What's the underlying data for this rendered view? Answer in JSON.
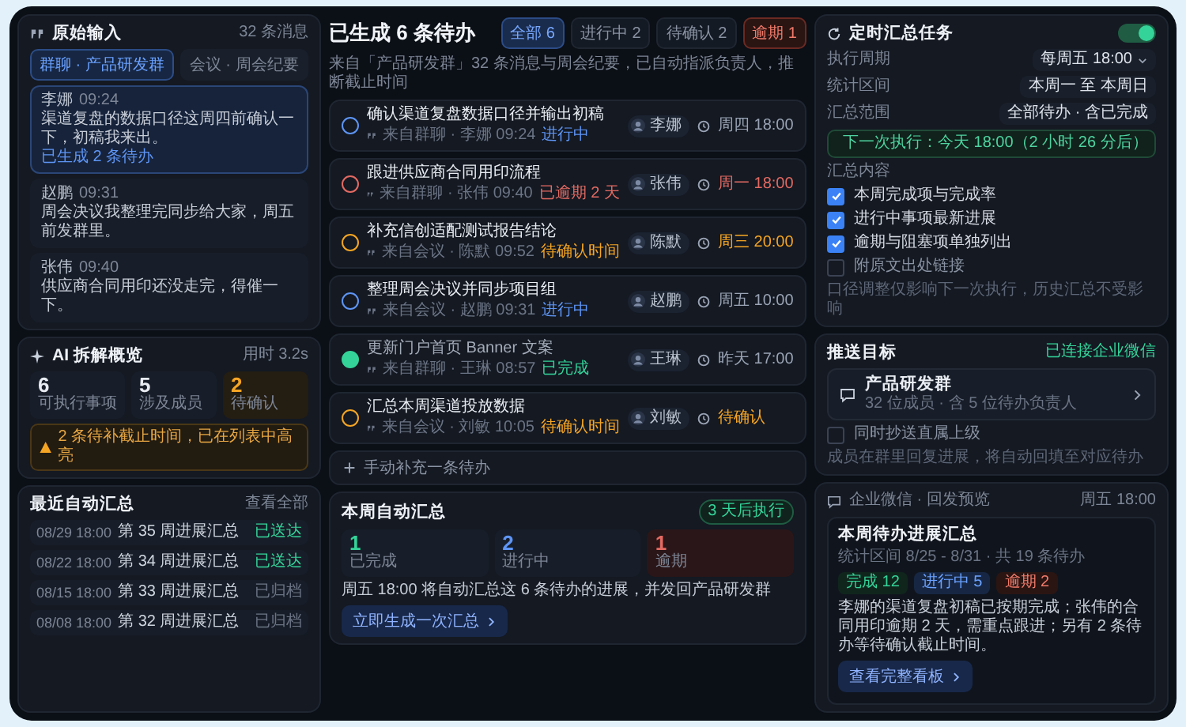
{
  "raw_input": {
    "title": "原始输入",
    "count": "32 条消息",
    "tabs": [
      {
        "label": "群聊 · 产品研发群",
        "selected": true
      },
      {
        "label": "会议 · 周会纪要",
        "selected": false
      }
    ],
    "messages": [
      {
        "author": "李娜",
        "time": "09:24",
        "text": "渠道复盘的数据口径这周四前确认一下，初稿我来出。",
        "note": "已生成 2 条待办",
        "selected": true
      },
      {
        "author": "赵鹏",
        "time": "09:31",
        "text": "周会决议我整理完同步给大家，周五前发群里。",
        "selected": false
      },
      {
        "author": "张伟",
        "time": "09:40",
        "text": "供应商合同用印还没走完，得催一下。",
        "selected": false
      }
    ]
  },
  "ai_overview": {
    "title": "AI 拆解概览",
    "time": "用时 3.2s",
    "stats": [
      {
        "value": "6",
        "label": "可执行事项",
        "kind": "normal"
      },
      {
        "value": "5",
        "label": "涉及成员",
        "kind": "normal"
      },
      {
        "value": "2",
        "label": "待确认",
        "kind": "warning"
      }
    ],
    "warning": "2 条待补截止时间，已在列表中高亮"
  },
  "recent_summaries": {
    "title": "最近自动汇总",
    "link": "查看全部",
    "items": [
      {
        "date": "08/29 18:00",
        "title": "第 35 周进展汇总",
        "status": "已送达",
        "kind": "delivered"
      },
      {
        "date": "08/22 18:00",
        "title": "第 34 周进展汇总",
        "status": "已送达",
        "kind": "delivered"
      },
      {
        "date": "08/15 18:00",
        "title": "第 33 周进展汇总",
        "status": "已归档",
        "kind": "archived"
      },
      {
        "date": "08/08 18:00",
        "title": "第 32 周进展汇总",
        "status": "已归档",
        "kind": "archived"
      }
    ]
  },
  "todos": {
    "title": "已生成 6 条待办",
    "subtitle": "来自「产品研发群」32 条消息与周会纪要，已自动指派负责人，推断截止时间",
    "filters": [
      {
        "label": "全部 6",
        "selected": true,
        "kind": "normal"
      },
      {
        "label": "进行中 2",
        "selected": false,
        "kind": "normal"
      },
      {
        "label": "待确认 2",
        "selected": false,
        "kind": "normal"
      },
      {
        "label": "逾期 1",
        "selected": false,
        "kind": "overdue"
      }
    ],
    "items": [
      {
        "title": "确认渠道复盘数据口径并输出初稿",
        "source": "来自群聊 · 李娜 09:24",
        "status": "进行中",
        "kind": "progress",
        "assignee": "李娜",
        "due": "周四 18:00"
      },
      {
        "title": "跟进供应商合同用印流程",
        "source": "来自群聊 · 张伟 09:40",
        "status": "已逾期 2 天",
        "kind": "overdue",
        "assignee": "张伟",
        "due": "周一 18:00"
      },
      {
        "title": "补充信创适配测试报告结论",
        "source": "来自会议 · 陈默 09:52",
        "status": "待确认时间",
        "kind": "pending",
        "assignee": "陈默",
        "due": "周三 20:00"
      },
      {
        "title": "整理周会决议并同步项目组",
        "source": "来自会议 · 赵鹏 09:31",
        "status": "进行中",
        "kind": "progress",
        "assignee": "赵鹏",
        "due": "周五 10:00"
      },
      {
        "title": "更新门户首页 Banner 文案",
        "source": "来自群聊 · 王琳 08:57",
        "status": "已完成",
        "kind": "done",
        "assignee": "王琳",
        "due": "昨天 17:00"
      },
      {
        "title": "汇总本周渠道投放数据",
        "source": "来自会议 · 刘敏 10:05",
        "status": "待确认时间",
        "kind": "pending",
        "assignee": "刘敏",
        "due": "待确认"
      }
    ],
    "add": "手动补充一条待办"
  },
  "weekly_summary": {
    "title": "本周自动汇总",
    "badge": "3 天后执行",
    "stats": [
      {
        "value": "1",
        "label": "已完成",
        "kind": "done"
      },
      {
        "value": "2",
        "label": "进行中",
        "kind": "progress"
      },
      {
        "value": "1",
        "label": "逾期",
        "kind": "overdue"
      }
    ],
    "note": "周五 18:00 将自动汇总这 6 条待办的进展，并发回产品研发群",
    "button": "立即生成一次汇总"
  },
  "schedule": {
    "title": "定时汇总任务",
    "enabled": true,
    "fields": [
      {
        "label": "执行周期",
        "value": "每周五 18:00",
        "kind": "dropdown"
      },
      {
        "label": "统计区间",
        "value": "本周一 至 本周日",
        "kind": "value"
      },
      {
        "label": "汇总范围",
        "value": "全部待办 · 含已完成",
        "kind": "value"
      }
    ],
    "next_run": "下一次执行：今天 18:00（2 小时 26 分后）",
    "content_label": "汇总内容",
    "options": [
      {
        "label": "本周完成项与完成率",
        "checked": true
      },
      {
        "label": "进行中事项最新进展",
        "checked": true
      },
      {
        "label": "逾期与阻塞项单独列出",
        "checked": true
      },
      {
        "label": "附原文出处链接",
        "checked": false
      }
    ],
    "footnote": "口径调整仅影响下一次执行，历史汇总不受影响"
  },
  "push_target": {
    "title": "推送目标",
    "status": "已连接企业微信",
    "group": "产品研发群",
    "group_info": "32 位成员 · 含 5 位待办负责人",
    "cc": {
      "label": "同时抄送直属上级",
      "checked": false
    },
    "note": "成员在群里回复进展，将自动回填至对应待办"
  },
  "preview": {
    "header": "企业微信 · 回发预览",
    "time": "周五 18:00",
    "title": "本周待办进展汇总",
    "meta": "统计区间 8/25 - 8/31 · 共 19 条待办",
    "tags": [
      {
        "label": "完成 12",
        "kind": "done"
      },
      {
        "label": "进行中 5",
        "kind": "progress"
      },
      {
        "label": "逾期 2",
        "kind": "overdue"
      }
    ],
    "body": "李娜的渠道复盘初稿已按期完成；张伟的合同用印逾期 2 天，需重点跟进；另有 2 条待办等待确认截止时间。",
    "button": "查看完整看板"
  }
}
